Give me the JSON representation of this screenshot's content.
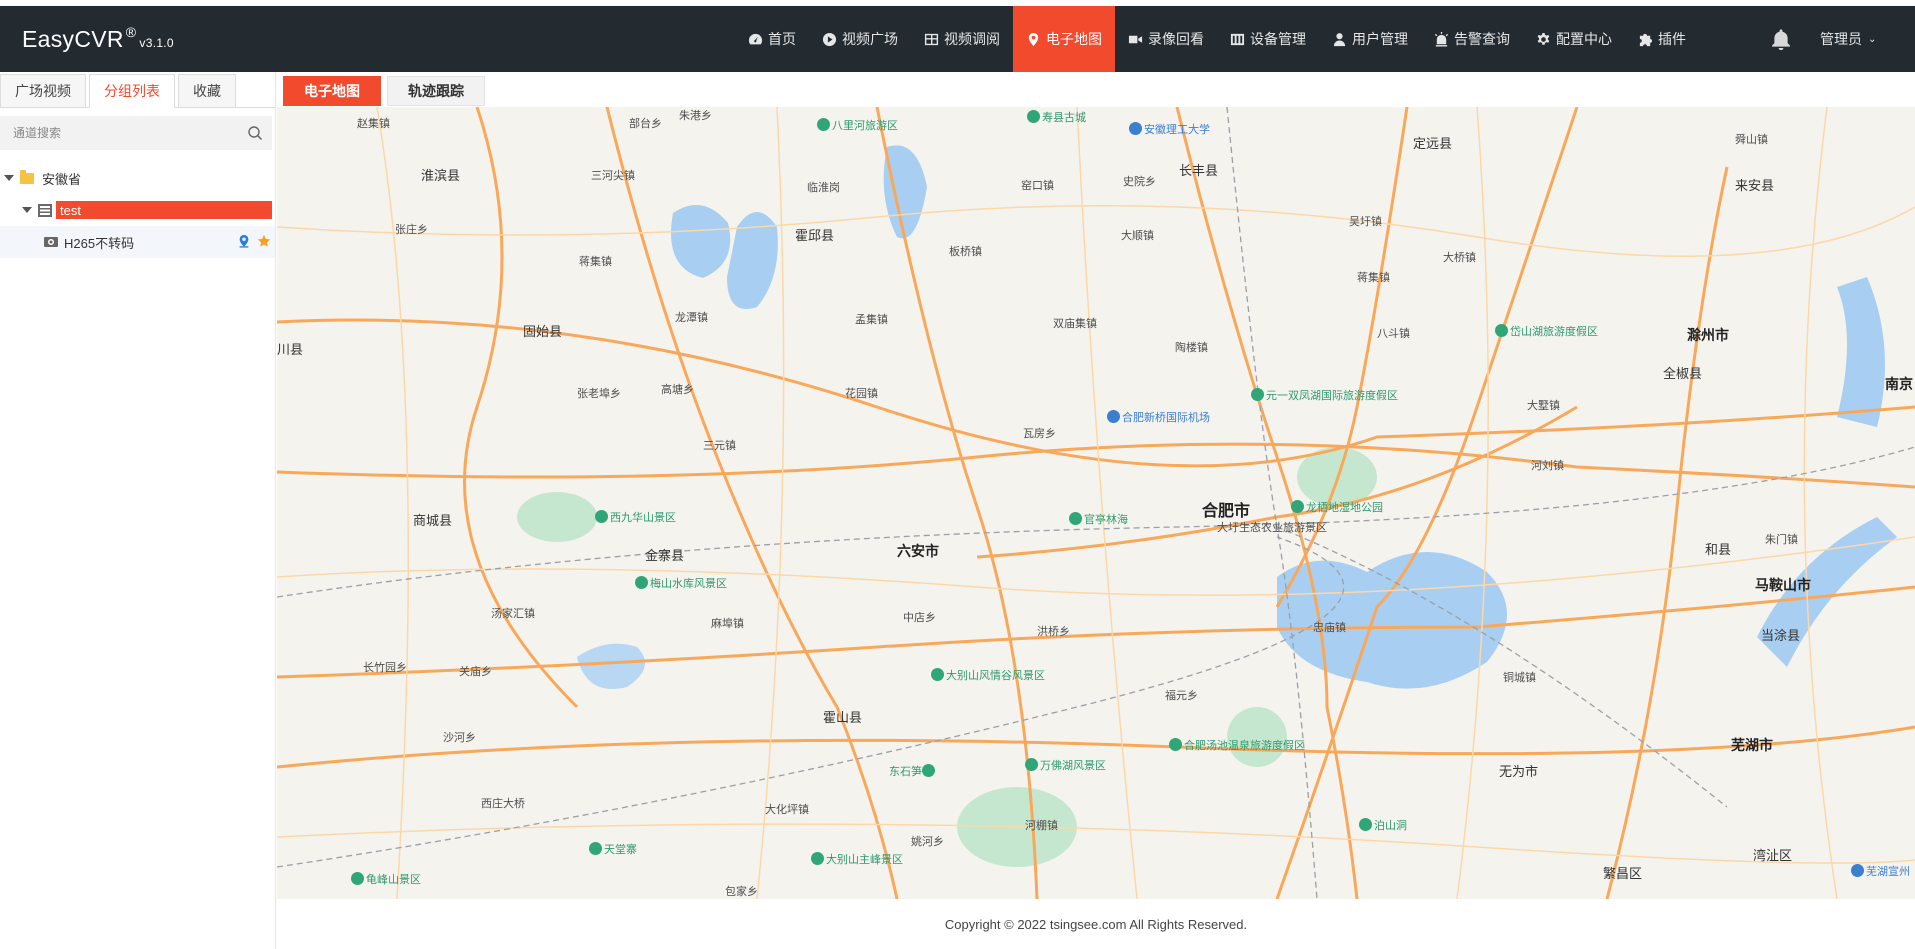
{
  "brand": {
    "name": "EasyCVR",
    "reg": "®",
    "version": "v3.1.0"
  },
  "nav": {
    "items": [
      {
        "label": "首页",
        "icon": "dashboard-icon"
      },
      {
        "label": "视频广场",
        "icon": "play-circle-icon"
      },
      {
        "label": "视频调阅",
        "icon": "grid-icon"
      },
      {
        "label": "电子地图",
        "icon": "map-pin-icon",
        "active": true
      },
      {
        "label": "录像回看",
        "icon": "video-camera-icon"
      },
      {
        "label": "设备管理",
        "icon": "server-icon"
      },
      {
        "label": "用户管理",
        "icon": "user-icon"
      },
      {
        "label": "告警查询",
        "icon": "alarm-icon"
      },
      {
        "label": "配置中心",
        "icon": "gear-icon"
      },
      {
        "label": "插件",
        "icon": "puzzle-icon"
      }
    ],
    "user": "管理员"
  },
  "left": {
    "tabs": [
      "广场视频",
      "分组列表",
      "收藏"
    ],
    "active_tab": "分组列表",
    "search_placeholder": "通道搜索",
    "tree": {
      "province": "安徽省",
      "group": "test",
      "channel": "H265不转码"
    }
  },
  "map_tabs": [
    "电子地图",
    "轨迹跟踪"
  ],
  "map": {
    "big_cities": [
      "合肥市",
      "六安市",
      "滁州市",
      "马鞍山市",
      "芜湖市",
      "南京"
    ],
    "counties": [
      "淮滨县",
      "固始县",
      "商城县",
      "金寨县",
      "霍邱县",
      "霍山县",
      "长丰县",
      "定远县",
      "来安县",
      "全椒县",
      "和县",
      "当涂县",
      "无为市",
      "繁昌区",
      "湾沚区",
      "川县"
    ],
    "towns": [
      "赵集镇",
      "部台乡",
      "朱港乡",
      "三河尖镇",
      "临淮岗",
      "张庄乡",
      "蒋集镇",
      "龙潭镇",
      "板桥镇",
      "窑口镇",
      "史院乡",
      "大顺镇",
      "孟集镇",
      "双庙集镇",
      "陶楼镇",
      "吴圩镇",
      "蒋集镇",
      "大桥镇",
      "八斗镇",
      "舜山镇",
      "张老埠乡",
      "高塘乡",
      "花园镇",
      "瓦房乡",
      "三元镇",
      "大墅镇",
      "河刘镇",
      "汤家汇镇",
      "麻埠镇",
      "中店乡",
      "洪桥乡",
      "忠庙镇",
      "铜城镇",
      "朱门镇",
      "长竹园乡",
      "关庙乡",
      "沙河乡",
      "福元乡",
      "西庄大桥",
      "大化坪镇",
      "姚河乡",
      "河棚镇",
      "包家乡"
    ],
    "pois": [
      "寿县古城",
      "八里河旅游区",
      "安徽理工大学",
      "元一双凤湖国际旅游度假区",
      "合肥新桥国际机场",
      "西九华山景区",
      "官亭林海",
      "龙栖地湿地公园",
      "大圩生态农业旅游景区",
      "梅山水库风景区",
      "大别山风情谷风景区",
      "合肥汤池温泉旅游度假区",
      "万佛湖风景区",
      "东石笋",
      "天堂寨",
      "大别山主峰景区",
      "龟峰山景区",
      "泊山洞",
      "芜湖宣州",
      "岱山湖旅游度假区"
    ]
  },
  "footer": "Copyright © 2022 tsingsee.com All Rights Reserved.",
  "colors": {
    "accent": "#f24a2d",
    "nav_bg": "#232a30",
    "map_bg": "#f5f3ee",
    "road": "#f9a85a",
    "water": "#a8cef2",
    "park": "#c6e7cf"
  }
}
